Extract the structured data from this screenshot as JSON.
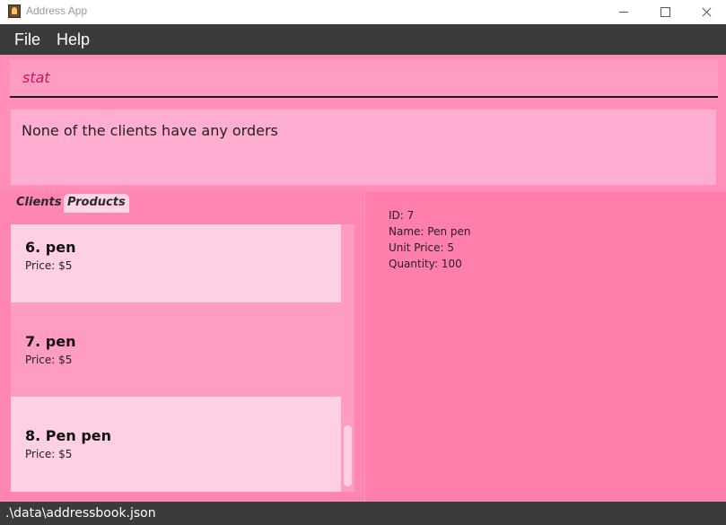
{
  "window": {
    "title": "Address App",
    "icon": "address-book-icon"
  },
  "menu": {
    "file_label": "File",
    "help_label": "Help"
  },
  "command": {
    "value": "stat"
  },
  "result": {
    "text": "None of the clients have any orders"
  },
  "tabs": [
    {
      "label": "Clients",
      "selected": false
    },
    {
      "label": "Products",
      "selected": true
    }
  ],
  "products": [
    {
      "name": "6.  pen",
      "price": "Price: $5"
    },
    {
      "name": "7.  pen",
      "price": "Price: $5"
    },
    {
      "name": "8.  Pen pen",
      "price": "Price: $5"
    }
  ],
  "detail": {
    "id": "ID: 7",
    "name": "Name: Pen pen",
    "unit_price": "Unit Price: 5",
    "quantity": "Quantity: 100"
  },
  "status": {
    "path": ".\\data\\addressbook.json"
  },
  "colors": {
    "background": "#ff7eab",
    "menubar": "#3b3b3b",
    "selected_card": "#ff9cc3",
    "card": "#ffcfe3"
  }
}
